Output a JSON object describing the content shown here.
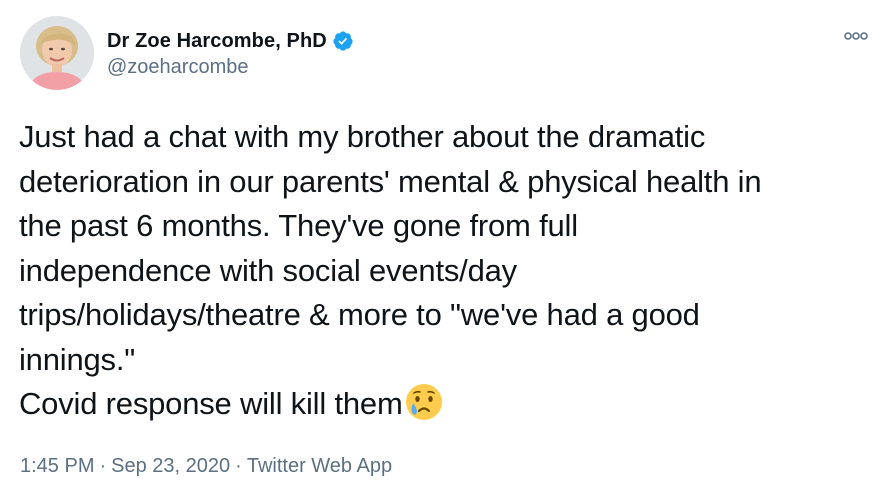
{
  "user": {
    "display_name": "Dr Zoe Harcombe, PhD",
    "handle": "@zoeharcombe",
    "verified": true
  },
  "more_icon": "more-horizontal-icon",
  "tweet": {
    "lines": [
      "Just had a chat with my brother about the dramatic",
      "deterioration in our parents' mental & physical health in",
      "the past 6 months. They've gone from full",
      "independence with social events/day",
      "trips/holidays/theatre & more to \"we've had a good",
      "innings.\"",
      "Covid response will kill them"
    ],
    "emoji": "crying-face-emoji"
  },
  "meta": {
    "time": "1:45 PM",
    "date": "Sep 23, 2020",
    "source": "Twitter Web App",
    "separator": "·"
  },
  "colors": {
    "text": "#0f1419",
    "secondary": "#5b7083",
    "verified": "#1da1f2"
  }
}
